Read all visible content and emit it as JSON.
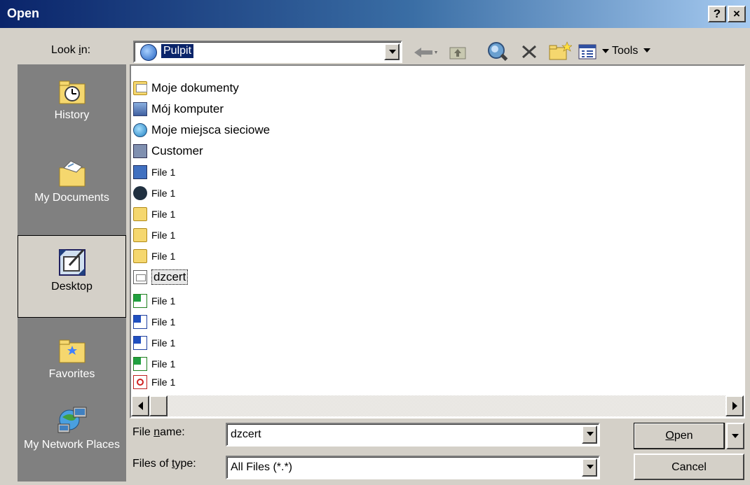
{
  "window": {
    "title": "Open",
    "help_button": "?",
    "close_button": "×"
  },
  "toolbar": {
    "look_in_label": "Look in:",
    "look_in_value": "Pulpit",
    "tools_label": "Tools",
    "icons": [
      "back-icon",
      "up-folder-icon",
      "search-web-icon",
      "delete-icon",
      "new-folder-icon",
      "views-icon"
    ]
  },
  "places": [
    {
      "label": "History",
      "icon": "history-icon"
    },
    {
      "label": "My Documents",
      "icon": "my-documents-icon"
    },
    {
      "label": "Desktop",
      "icon": "desktop-icon",
      "selected": true
    },
    {
      "label": "Favorites",
      "icon": "favorites-icon"
    },
    {
      "label": "My Network Places",
      "icon": "network-places-icon"
    }
  ],
  "files": [
    {
      "name": "Moje dokumenty",
      "icon": "my-documents-icon"
    },
    {
      "name": "Mój komputer",
      "icon": "computer-icon"
    },
    {
      "name": "Moje miejsca sieciowe",
      "icon": "network-icon"
    },
    {
      "name": "Customer",
      "icon": "shortcut-icon"
    },
    {
      "name": "File 1",
      "icon": "shortcut-icon"
    },
    {
      "name": "File 1",
      "icon": "app-shortcut-icon"
    },
    {
      "name": "File 1",
      "icon": "folder-icon"
    },
    {
      "name": "File 1",
      "icon": "folder-icon"
    },
    {
      "name": "File 1",
      "icon": "folder-icon"
    },
    {
      "name": "dzcert",
      "icon": "certificate-icon",
      "selected": true
    },
    {
      "name": "File 1",
      "icon": "excel-icon"
    },
    {
      "name": "File 1",
      "icon": "word-icon"
    },
    {
      "name": "File 1",
      "icon": "word-icon"
    },
    {
      "name": "File 1",
      "icon": "excel-icon"
    },
    {
      "name": "File 1",
      "icon": "pdf-icon"
    }
  ],
  "form": {
    "file_name_label": "File name:",
    "file_name_value": "dzcert",
    "file_type_label": "Files of type:",
    "file_type_value": "All Files (*.*)"
  },
  "buttons": {
    "open": "Open",
    "cancel": "Cancel"
  }
}
